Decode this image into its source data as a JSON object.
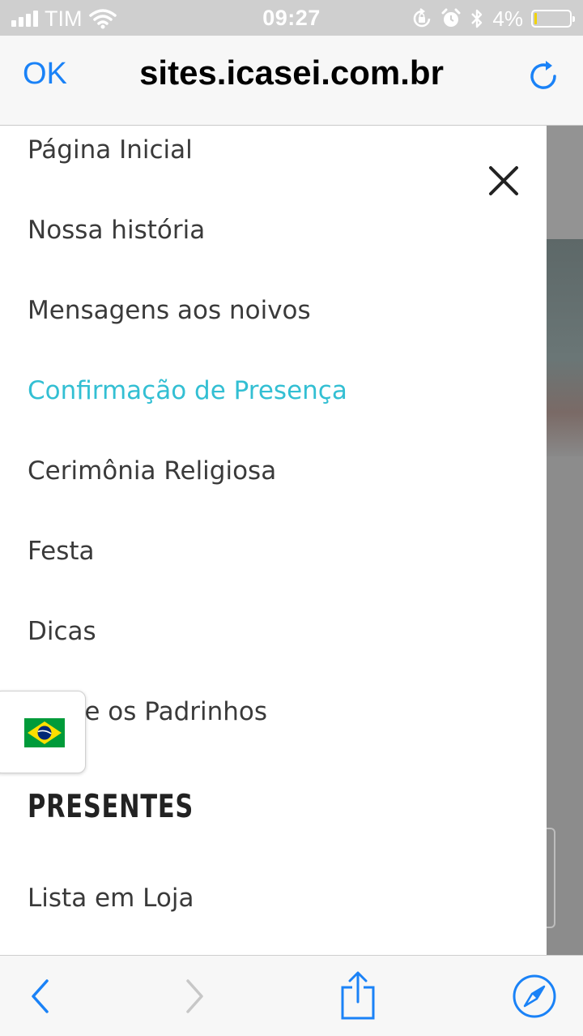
{
  "status_bar": {
    "carrier": "TIM",
    "time": "09:27",
    "battery_text": "4%",
    "battery_level": 0.04,
    "icons": [
      "signal-icon",
      "wifi-icon",
      "orientation-lock-icon",
      "alarm-icon",
      "bluetooth-icon",
      "battery-icon"
    ]
  },
  "browser": {
    "done_label": "OK",
    "url": "sites.icasei.com.br",
    "accent_color": "#1a82f7"
  },
  "menu": {
    "items": [
      {
        "label": "Página Inicial",
        "active": false
      },
      {
        "label": "Nossa história",
        "active": false
      },
      {
        "label": "Mensagens aos noivos",
        "active": false
      },
      {
        "label": "Confirmação de Presença",
        "active": true
      },
      {
        "label": "Cerimônia Religiosa",
        "active": false
      },
      {
        "label": "Festa",
        "active": false
      },
      {
        "label": "Dicas",
        "active": false
      },
      {
        "label": "Sobre os Padrinhos",
        "active": false
      }
    ],
    "section_heading": "PRESENTES",
    "section_items": [
      {
        "label": "Lista em Loja"
      }
    ],
    "active_color": "#33bfd3"
  },
  "language": {
    "flag_icon": "brazil-flag-icon"
  },
  "toolbar": {
    "icons": [
      "back-icon",
      "forward-icon",
      "share-icon",
      "compass-icon"
    ]
  }
}
